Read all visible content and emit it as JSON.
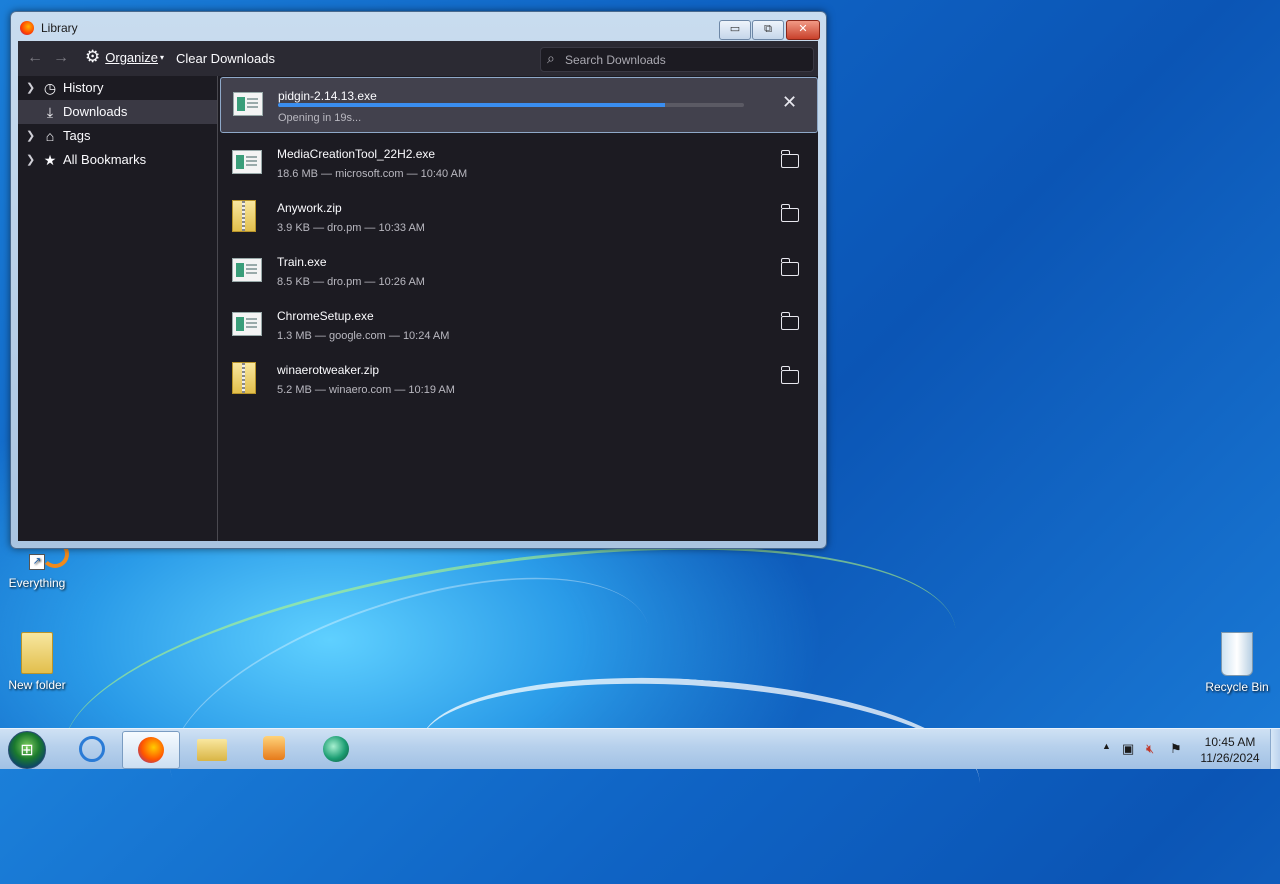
{
  "window": {
    "title": "Library",
    "min_label": "▭",
    "max_label": "⧉",
    "close_label": "✕"
  },
  "toolbar": {
    "back_icon": "←",
    "forward_icon": "→",
    "organize_label": "Organize",
    "clear_label": "Clear Downloads",
    "search_placeholder": "Search Downloads"
  },
  "sidebar": {
    "items": [
      {
        "label": "History",
        "icon": "clock-icon",
        "expandable": true,
        "selected": false
      },
      {
        "label": "Downloads",
        "icon": "download-icon",
        "expandable": false,
        "selected": true
      },
      {
        "label": "Tags",
        "icon": "tag-icon",
        "expandable": true,
        "selected": false
      },
      {
        "label": "All Bookmarks",
        "icon": "star-icon",
        "expandable": true,
        "selected": false
      }
    ]
  },
  "downloads": [
    {
      "name": "pidgin-2.14.13.exe",
      "status": "Opening in 19s...",
      "type": "exe",
      "progress": 0.83,
      "action": "cancel"
    },
    {
      "name": "MediaCreationTool_22H2.exe",
      "status": "18.6 MB — microsoft.com — 10:40 AM",
      "type": "exe",
      "action": "show-in-folder"
    },
    {
      "name": "Anywork.zip",
      "status": "3.9 KB — dro.pm — 10:33 AM",
      "type": "zip",
      "action": "show-in-folder"
    },
    {
      "name": "Train.exe",
      "status": "8.5 KB — dro.pm — 10:26 AM",
      "type": "exe",
      "action": "show-in-folder"
    },
    {
      "name": "ChromeSetup.exe",
      "status": "1.3 MB — google.com — 10:24 AM",
      "type": "exe",
      "action": "show-in-folder"
    },
    {
      "name": "winaerotweaker.zip",
      "status": "5.2 MB — winaero.com — 10:19 AM",
      "type": "zip",
      "action": "show-in-folder"
    }
  ],
  "desktop": {
    "icons": [
      {
        "label": "Everything"
      },
      {
        "label": "New folder"
      },
      {
        "label": "Recycle Bin"
      }
    ]
  },
  "taskbar": {
    "time": "10:45 AM",
    "date": "11/26/2024",
    "apps": [
      "internet-explorer-icon",
      "firefox-icon",
      "file-explorer-icon",
      "media-player-icon",
      "camera-app-icon"
    ]
  },
  "colors": {
    "accent": "#3a8ef0",
    "panel_bg": "#1c1b22",
    "toolbar_bg": "#2b2a33"
  }
}
